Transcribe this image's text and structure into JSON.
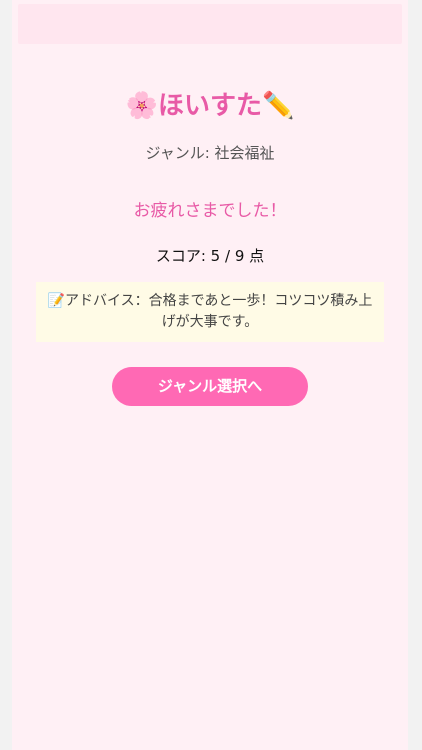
{
  "header": {
    "title_icon_left": "🌸",
    "title_text": "ほいすた",
    "title_icon_right": "✏️"
  },
  "result": {
    "genre_label": "ジャンル: 社会福祉",
    "thanks_message": "お疲れさまでした！",
    "score_text": "スコア: 5 / 9 点"
  },
  "advice": {
    "icon": "📝",
    "text": "アドバイス：合格まであと一歩！コツコツ積み上げが大事です。"
  },
  "actions": {
    "back_to_genre_label": "ジャンル選択へ"
  },
  "colors": {
    "accent": "#e85aa6",
    "button": "#ff69b4",
    "background": "#fff0f5",
    "advice_background": "#fffbe6"
  }
}
